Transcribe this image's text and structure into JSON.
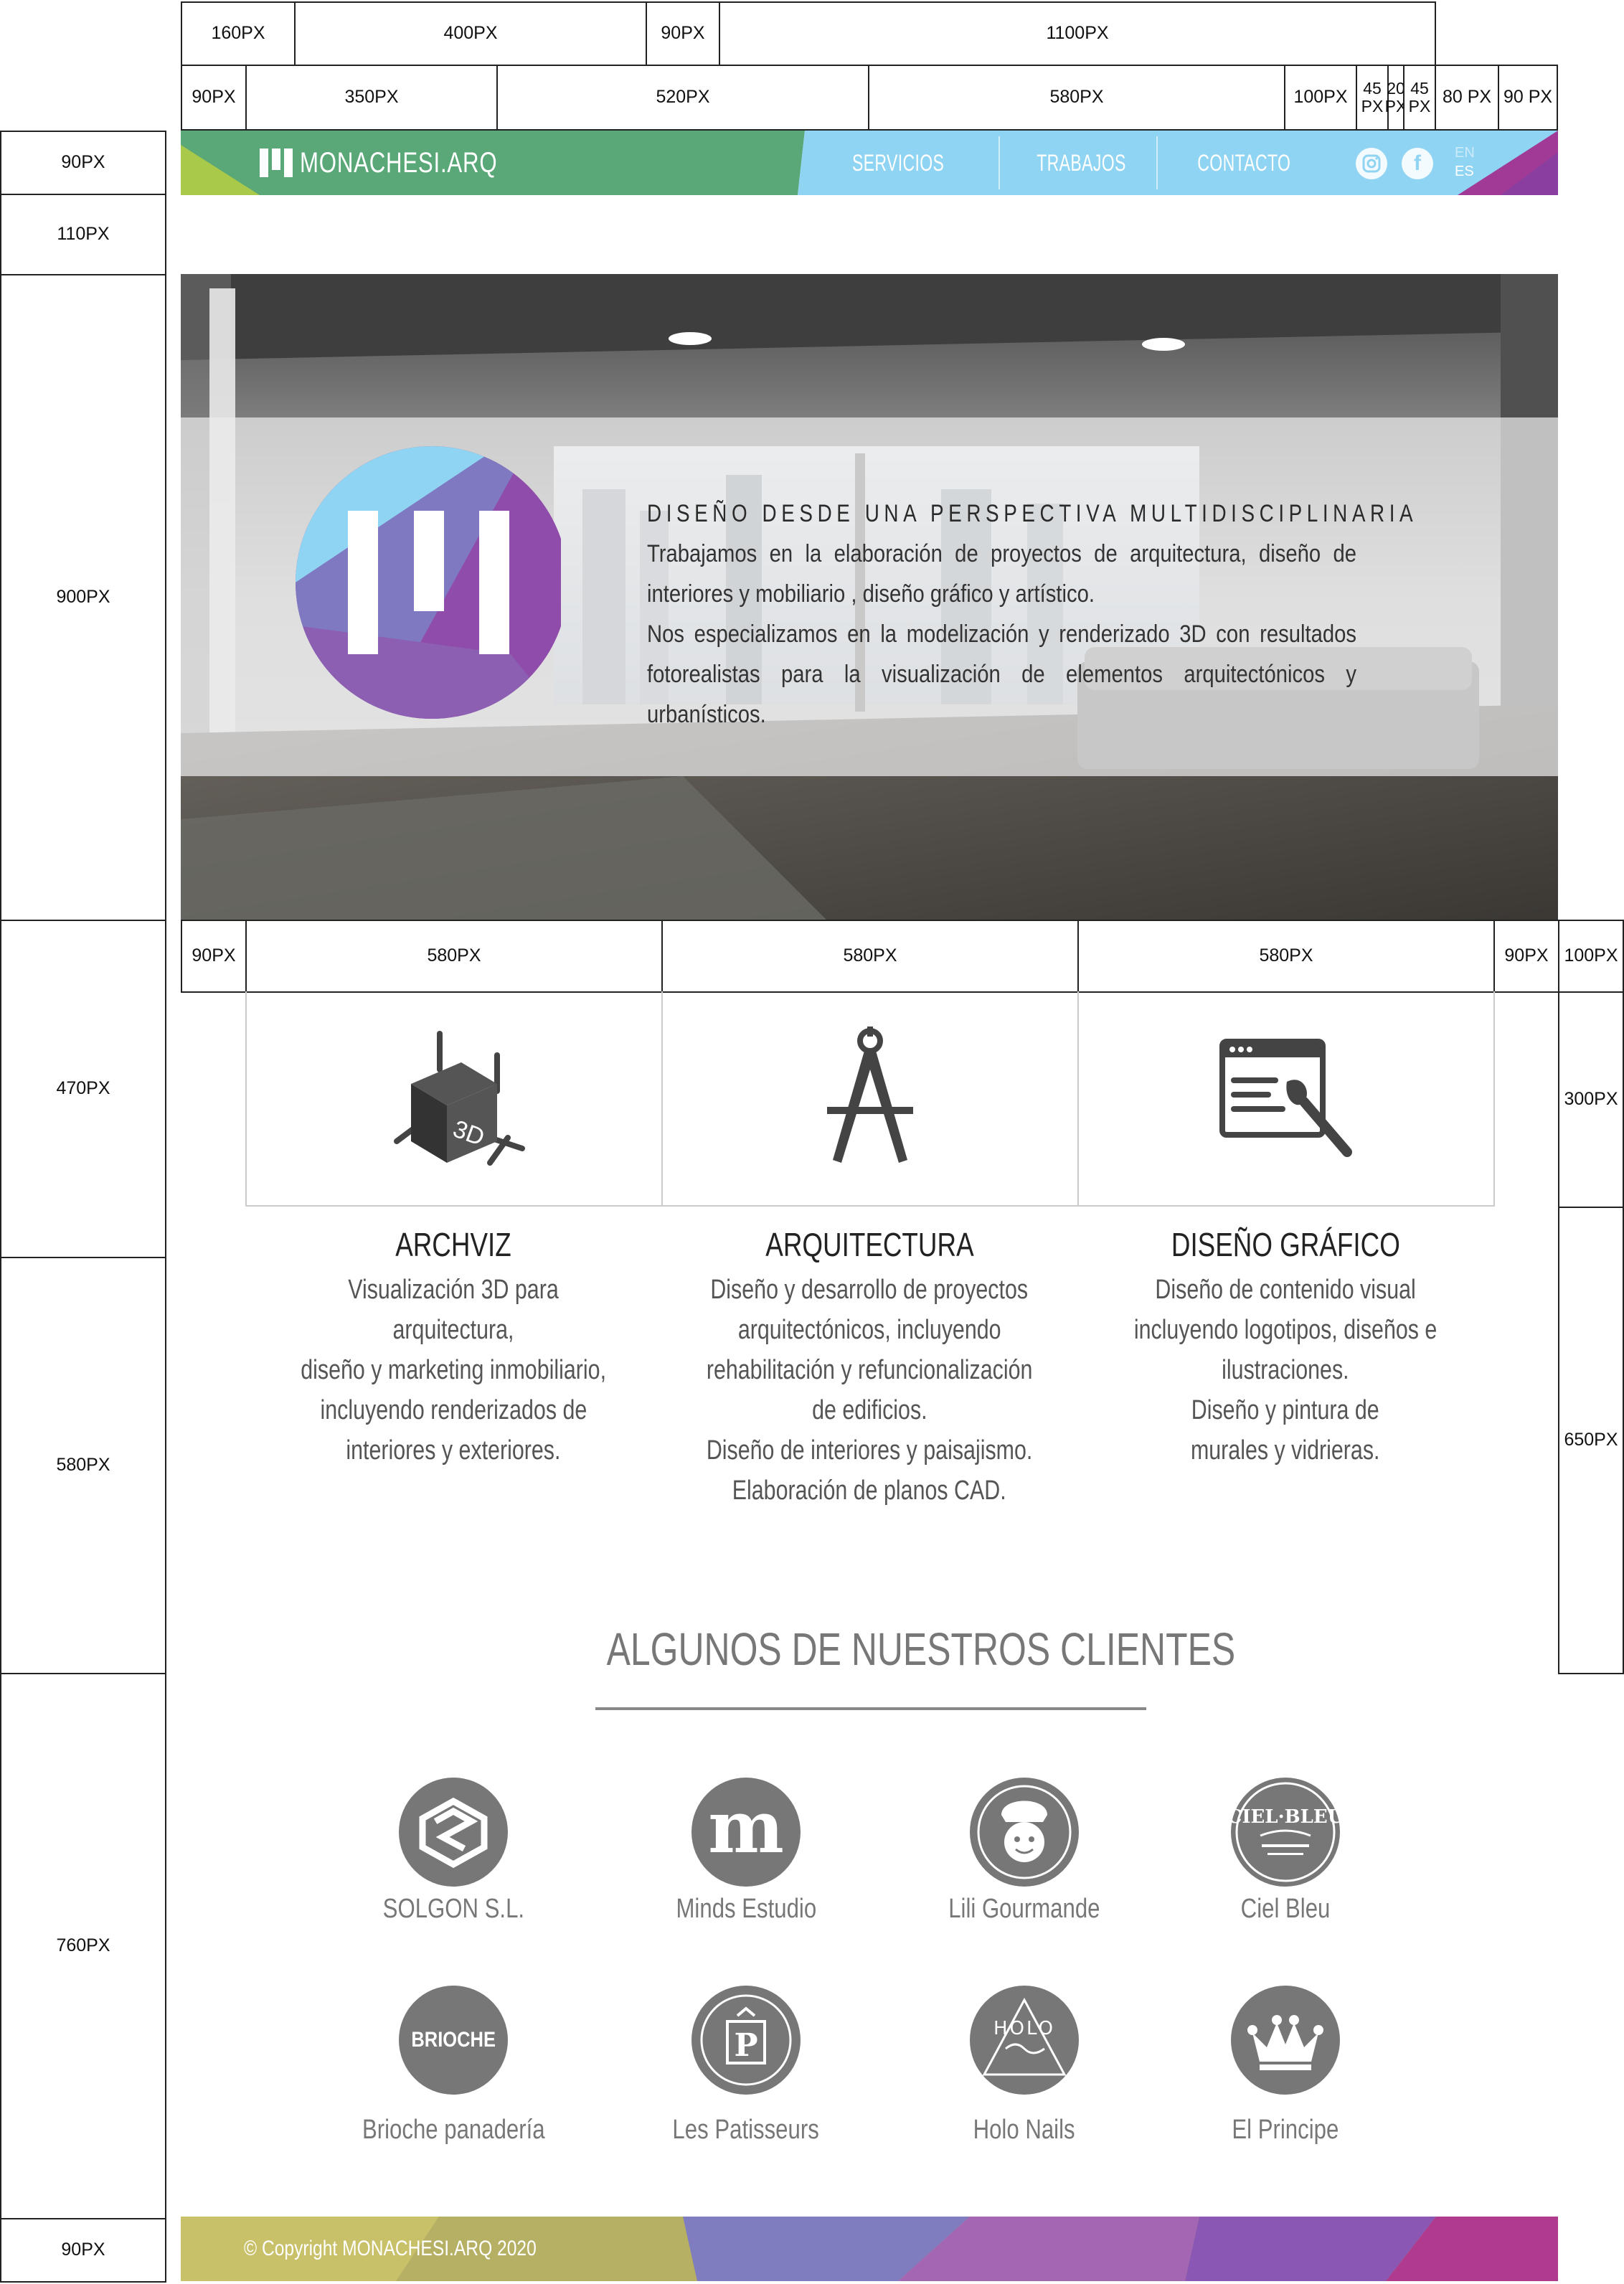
{
  "measurements": {
    "top_row": [
      "160PX",
      "400PX",
      "90PX",
      "1100PX"
    ],
    "second_row": [
      "90PX",
      "350PX",
      "520PX",
      "580PX",
      "100PX",
      "45 PX",
      "20 PX",
      "45 PX",
      "80 PX",
      "90 PX"
    ],
    "left_column": [
      "90PX",
      "110PX",
      "900PX",
      "470PX",
      "580PX",
      "760PX",
      "90PX"
    ],
    "services_row": [
      "90PX",
      "580PX",
      "580PX",
      "580PX",
      "90PX"
    ],
    "right_column": [
      "100PX",
      "300PX",
      "650PX"
    ]
  },
  "header": {
    "logo_text": "MONACHESI.ARQ",
    "nav": [
      "SERVICIOS",
      "TRABAJOS",
      "CONTACTO"
    ],
    "lang_en": "EN",
    "lang_es": "ES",
    "colors": {
      "green": "#5aa877",
      "lime": "#a8c94a",
      "blue": "#8fd4f2",
      "purple": "#8a3fa0",
      "magenta": "#b03a8e"
    }
  },
  "hero": {
    "title": "DISEÑO DESDE UNA PERSPECTIVA MULTIDISCIPLINARIA",
    "text1": "Trabajamos en la elaboración de proyectos de arquitectura, diseño de interiores y mobiliario , diseño gráfico y artístico.",
    "text2": "Nos especializamos en la modelización y renderizado 3D con resultados fotorealistas para la visualización de elementos arquitectónicos y urbanísticos."
  },
  "services": [
    {
      "title": "ARCHVIZ",
      "lines": [
        "Visualización 3D para arquitectura,",
        "diseño y marketing inmobiliario,",
        "incluyendo renderizados de",
        "interiores y exteriores."
      ],
      "icon": "cube-3d-icon"
    },
    {
      "title": "ARQUITECTURA",
      "lines": [
        "Diseño y desarrollo de proyectos",
        "arquitectónicos, incluyendo",
        "rehabilitación y refuncionalización",
        "de edificios.",
        "Diseño de interiores y paisajismo.",
        "Elaboración de planos CAD."
      ],
      "icon": "compass-icon"
    },
    {
      "title": "DISEÑO GRÁFICO",
      "lines": [
        "Diseño de contenido visual",
        "incluyendo logotipos, diseños e",
        "ilustraciones.",
        "Diseño y pintura de",
        "murales y vidrieras."
      ],
      "icon": "design-brush-icon"
    }
  ],
  "clients": {
    "title": "ALGUNOS DE NUESTROS CLIENTES",
    "items": [
      {
        "name": "SOLGON S.L.",
        "icon": "solgon-logo"
      },
      {
        "name": "Minds Estudio",
        "icon": "minds-logo",
        "mark": "m"
      },
      {
        "name": "Lili Gourmande",
        "icon": "lili-logo"
      },
      {
        "name": "Ciel Bleu",
        "icon": "ciel-bleu-logo",
        "mark": "CIEL·BLEU"
      },
      {
        "name": "Brioche panadería",
        "icon": "brioche-logo",
        "mark": "BRIOCHE"
      },
      {
        "name": "Les Patisseurs",
        "icon": "patisseurs-logo",
        "mark": "P"
      },
      {
        "name": "Holo Nails",
        "icon": "holo-nails-logo",
        "mark": "HOLO"
      },
      {
        "name": "El Principe",
        "icon": "el-principe-logo"
      }
    ]
  },
  "footer": {
    "copyright": "© Copyright MONACHESI.ARQ 2020"
  }
}
